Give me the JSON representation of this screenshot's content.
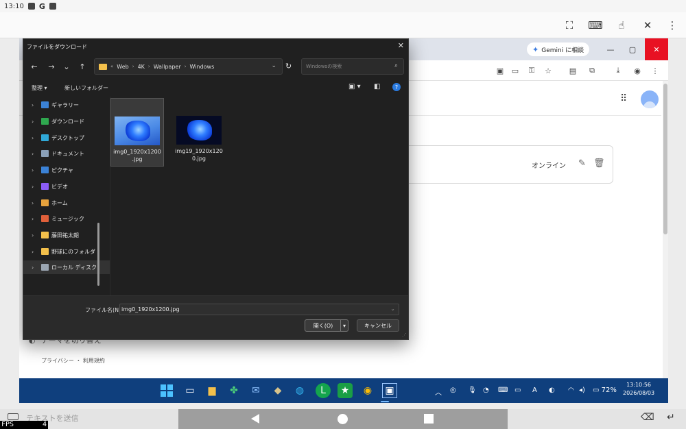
{
  "status_bar": {
    "time": "13:10",
    "g_label": "G"
  },
  "remote_toolbar": {
    "icons": [
      "fullscreen-icon",
      "keyboard-off-icon",
      "touch-icon",
      "pin-off-icon",
      "more-vert-icon"
    ]
  },
  "chrome": {
    "gemini_label": "Gemini に相談",
    "win_minimize": "—",
    "win_restore": "▢",
    "win_close": "✕",
    "card_status": "オンライン",
    "theme_label": "テーマを切り替え",
    "footer": "プライバシー ・ 利用規約"
  },
  "dialog": {
    "title": "ファイルをダウンロード",
    "close": "✕",
    "breadcrumb": [
      "Web",
      "4K",
      "Wallpaper",
      "Windows"
    ],
    "breadcrumb_prefix": "«",
    "search_placeholder": "Windowsの検索",
    "cmd_organize": "整理",
    "cmd_new_folder": "新しいフォルダー",
    "tree": [
      {
        "label": "ギャラリー",
        "color": "#3b82d6"
      },
      {
        "label": "ダウンロード",
        "color": "#2fa84f"
      },
      {
        "label": "デスクトップ",
        "color": "#30a9d8"
      },
      {
        "label": "ドキュメント",
        "color": "#8aa0b8"
      },
      {
        "label": "ピクチャ",
        "color": "#3b82d6"
      },
      {
        "label": "ビデオ",
        "color": "#8b5cf6"
      },
      {
        "label": "ホーム",
        "color": "#e8a33d"
      },
      {
        "label": "ミュージック",
        "color": "#e0603a"
      },
      {
        "label": "藤田祐太朗",
        "color": "#f3c04b"
      },
      {
        "label": "野球にのフォルダ",
        "color": "#f3c04b"
      },
      {
        "label": "ローカル ディスク",
        "color": "#9aa5b1"
      }
    ],
    "files": [
      {
        "name_line1": "img0_1920x1200",
        "name_line2": ".jpg"
      },
      {
        "name_line1": "img19_1920x120",
        "name_line2": "0.jpg"
      }
    ],
    "filename_label": "ファイル名(N):",
    "filename_value": "img0_1920x1200.jpg",
    "open_label": "開く(O)",
    "cancel_label": "キャンセル"
  },
  "taskbar": {
    "battery": "72%",
    "time": "13:10:56",
    "date": "2026/08/03",
    "font_icon": "A"
  },
  "bottom": {
    "input_placeholder": "テキストを送信",
    "fps_label": "FPS",
    "fps_value": "4"
  }
}
